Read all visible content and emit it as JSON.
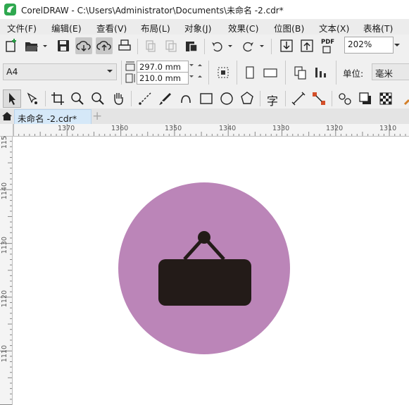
{
  "window": {
    "title": "CorelDRAW - C:\\Users\\Administrator\\Documents\\未命名 -2.cdr*"
  },
  "menu": {
    "items": [
      {
        "label": "文件(F)"
      },
      {
        "label": "编辑(E)"
      },
      {
        "label": "查看(V)"
      },
      {
        "label": "布局(L)"
      },
      {
        "label": "对象(J)"
      },
      {
        "label": "效果(C)"
      },
      {
        "label": "位图(B)"
      },
      {
        "label": "文本(X)"
      },
      {
        "label": "表格(T)"
      }
    ]
  },
  "standard_toolbar": {
    "pdf_label": "PDF",
    "zoom_level": "202%"
  },
  "property_bar": {
    "page_size": "A4",
    "width": "297.0 mm",
    "height": "210.0 mm",
    "units_label": "单位:",
    "units_value": "毫米"
  },
  "toolbox": {
    "text_tool_glyph": "字"
  },
  "document_tab": {
    "label": "未命名 -2.cdr*",
    "add_tab_glyph": "+"
  },
  "rulers": {
    "horizontal_ticks": [
      "1370",
      "1360",
      "1350",
      "1340",
      "1330",
      "1320",
      "1310"
    ],
    "vertical_ticks": [
      "115",
      "1140",
      "1130",
      "1120",
      "1110"
    ]
  },
  "artwork": {
    "circle_color": "#bb85b8",
    "sign_color": "#231b18",
    "icon": "hanging-sign-icon"
  }
}
